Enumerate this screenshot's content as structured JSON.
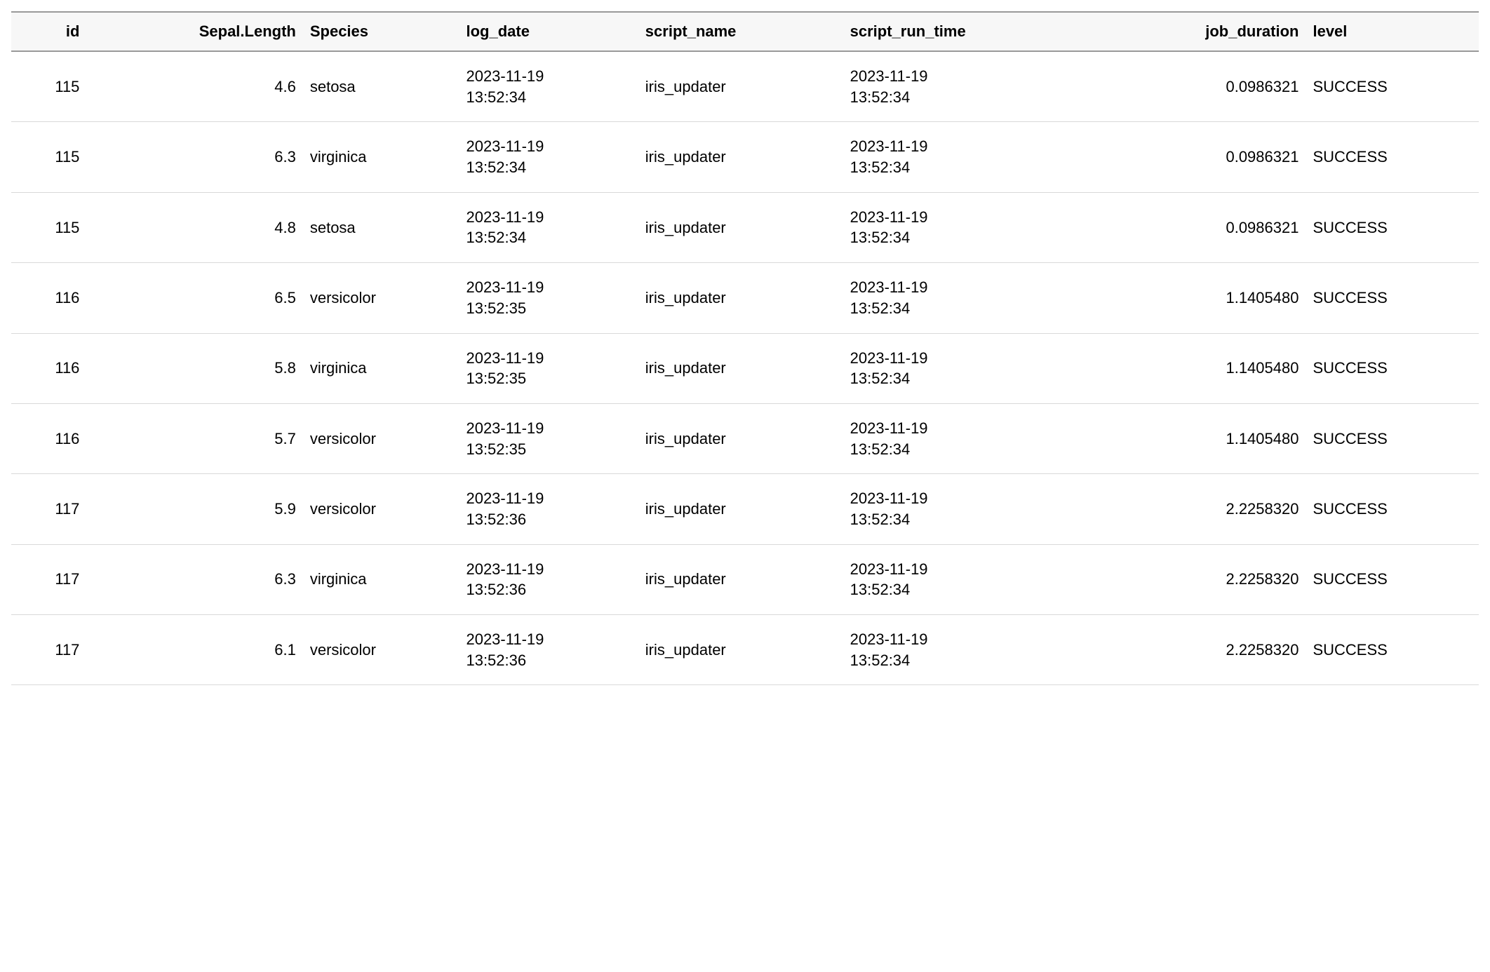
{
  "table": {
    "headers": [
      {
        "label": "id",
        "align": "right"
      },
      {
        "label": "Sepal.Length",
        "align": "right"
      },
      {
        "label": "Species",
        "align": "left"
      },
      {
        "label": "log_date",
        "align": "left"
      },
      {
        "label": "script_name",
        "align": "left"
      },
      {
        "label": "script_run_time",
        "align": "left"
      },
      {
        "label": "job_duration",
        "align": "right"
      },
      {
        "label": "level",
        "align": "left"
      }
    ],
    "rows": [
      {
        "id": "115",
        "sepal_length": "4.6",
        "species": "setosa",
        "log_date_line1": "2023-11-19",
        "log_date_line2": "13:52:34",
        "script_name": "iris_updater",
        "script_run_time_line1": "2023-11-19",
        "script_run_time_line2": "13:52:34",
        "job_duration": "0.0986321",
        "level": "SUCCESS"
      },
      {
        "id": "115",
        "sepal_length": "6.3",
        "species": "virginica",
        "log_date_line1": "2023-11-19",
        "log_date_line2": "13:52:34",
        "script_name": "iris_updater",
        "script_run_time_line1": "2023-11-19",
        "script_run_time_line2": "13:52:34",
        "job_duration": "0.0986321",
        "level": "SUCCESS"
      },
      {
        "id": "115",
        "sepal_length": "4.8",
        "species": "setosa",
        "log_date_line1": "2023-11-19",
        "log_date_line2": "13:52:34",
        "script_name": "iris_updater",
        "script_run_time_line1": "2023-11-19",
        "script_run_time_line2": "13:52:34",
        "job_duration": "0.0986321",
        "level": "SUCCESS"
      },
      {
        "id": "116",
        "sepal_length": "6.5",
        "species": "versicolor",
        "log_date_line1": "2023-11-19",
        "log_date_line2": "13:52:35",
        "script_name": "iris_updater",
        "script_run_time_line1": "2023-11-19",
        "script_run_time_line2": "13:52:34",
        "job_duration": "1.1405480",
        "level": "SUCCESS"
      },
      {
        "id": "116",
        "sepal_length": "5.8",
        "species": "virginica",
        "log_date_line1": "2023-11-19",
        "log_date_line2": "13:52:35",
        "script_name": "iris_updater",
        "script_run_time_line1": "2023-11-19",
        "script_run_time_line2": "13:52:34",
        "job_duration": "1.1405480",
        "level": "SUCCESS"
      },
      {
        "id": "116",
        "sepal_length": "5.7",
        "species": "versicolor",
        "log_date_line1": "2023-11-19",
        "log_date_line2": "13:52:35",
        "script_name": "iris_updater",
        "script_run_time_line1": "2023-11-19",
        "script_run_time_line2": "13:52:34",
        "job_duration": "1.1405480",
        "level": "SUCCESS"
      },
      {
        "id": "117",
        "sepal_length": "5.9",
        "species": "versicolor",
        "log_date_line1": "2023-11-19",
        "log_date_line2": "13:52:36",
        "script_name": "iris_updater",
        "script_run_time_line1": "2023-11-19",
        "script_run_time_line2": "13:52:34",
        "job_duration": "2.2258320",
        "level": "SUCCESS"
      },
      {
        "id": "117",
        "sepal_length": "6.3",
        "species": "virginica",
        "log_date_line1": "2023-11-19",
        "log_date_line2": "13:52:36",
        "script_name": "iris_updater",
        "script_run_time_line1": "2023-11-19",
        "script_run_time_line2": "13:52:34",
        "job_duration": "2.2258320",
        "level": "SUCCESS"
      },
      {
        "id": "117",
        "sepal_length": "6.1",
        "species": "versicolor",
        "log_date_line1": "2023-11-19",
        "log_date_line2": "13:52:36",
        "script_name": "iris_updater",
        "script_run_time_line1": "2023-11-19",
        "script_run_time_line2": "13:52:34",
        "job_duration": "2.2258320",
        "level": "SUCCESS"
      }
    ]
  }
}
